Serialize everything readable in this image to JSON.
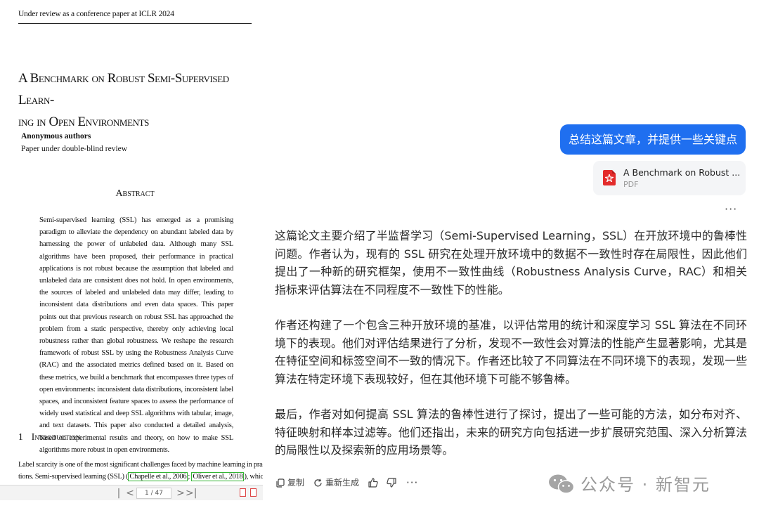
{
  "pdf": {
    "header": "Under review as a conference paper at ICLR 2024",
    "title_line1": "A Benchmark on Robust Semi-Supervised Learn-",
    "title_line2": "ing in Open Environments",
    "authors": "Anonymous authors",
    "review_note": "Paper under double-blind review",
    "abstract_heading": "Abstract",
    "abstract_text": "Semi-supervised learning (SSL) has emerged as a promising paradigm to alleviate the dependency on abundant labeled data by harnessing the power of unlabeled data. Although many SSL algorithms have been proposed, their performance in practical applications is not robust because the assumption that labeled and unlabeled data are consistent does not hold. In open environments, the sources of labeled and unlabeled data may differ, leading to inconsistent data distributions and even data spaces. This paper points out that previous research on robust SSL has approached the problem from a static perspective, thereby only achieving local robustness rather than global robustness. We reshape the research framework of robust SSL by using the Robustness Analysis Curve (RAC) and the associated metrics defined based on it. Based on these metrics, we build a benchmark that encompasses three types of open environments: inconsistent data distributions, inconsistent label spaces, and inconsistent feature spaces to assess the performance of widely used statistical and deep SSL algorithms with tabular, image, and text datasets. This paper also conducted a detailed analysis, based on experimental results and theory, on how to make SSL algorithms more robust in open environments.",
    "intro_number": "1",
    "intro_heading": "Introduction",
    "intro_line1": "Label scarcity is one of the most significant challenges faced by machine learning in practical applica-",
    "intro_line2_pre": "tions. Semi-supervised learning (SSL) ",
    "intro_cite1": "Chapelle et al., 2006",
    "intro_cite2": "Oliver et al., 2018",
    "intro_line2_post": ", which is a promising",
    "toolbar": {
      "first": "|<",
      "prev": "<",
      "page_indicator": "1 / 47",
      "next": ">",
      "last": ">|"
    }
  },
  "chat": {
    "user_message": "总结这篇文章，并提供一些关键点",
    "attachment": {
      "name": "A Benchmark on Robust ...",
      "type": "PDF"
    },
    "more_glyph": "···",
    "answer_paragraphs": [
      "这篇论文主要介绍了半监督学习（Semi-Supervised Learning，SSL）在开放环境中的鲁棒性问题。作者认为，现有的 SSL 研究在处理开放环境中的数据不一致性时存在局限性，因此他们提出了一种新的研究框架，使用不一致性曲线（Robustness Analysis Curve，RAC）和相关指标来评估算法在不同程度不一致性下的性能。",
      "作者还构建了一个包含三种开放环境的基准，以评估常用的统计和深度学习 SSL 算法在不同环境下的表现。他们对评估结果进行了分析，发现不一致性会对算法的性能产生显著影响，尤其是在特征空间和标签空间不一致的情况下。作者还比较了不同算法在不同环境下的表现，发现一些算法在特定环境下表现较好，但在其他环境下可能不够鲁棒。",
      "最后，作者对如何提高 SSL 算法的鲁棒性进行了探讨，提出了一些可能的方法，如分布对齐、特征映射和样本过滤等。他们还指出，未来的研究方向包括进一步扩展研究范围、深入分析算法的局限性以及探索新的应用场景等。"
    ],
    "actions": {
      "copy": "复制",
      "regenerate": "重新生成",
      "more": "···"
    }
  },
  "watermark": {
    "text": "公众号 · 新智元"
  },
  "colors": {
    "user_bubble": "#1f6ff0",
    "pdf_icon": "#e32b2b",
    "citation_box": "#35b535"
  }
}
